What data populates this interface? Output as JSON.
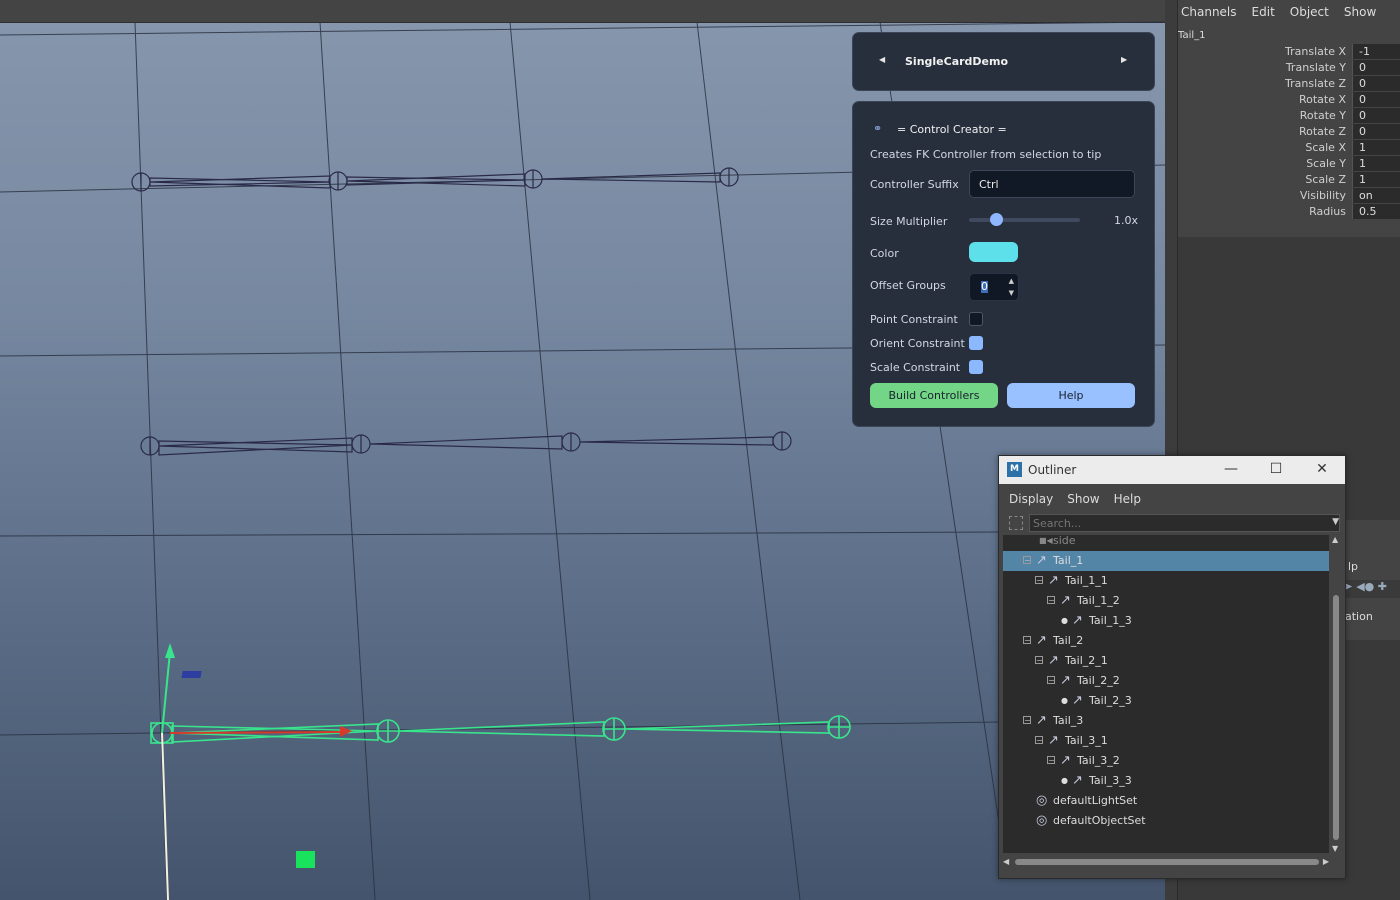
{
  "channel_box": {
    "menu": [
      "Channels",
      "Edit",
      "Object",
      "Show"
    ],
    "object_name": "Tail_1",
    "attributes": [
      {
        "label": "Translate X",
        "value": "-1"
      },
      {
        "label": "Translate Y",
        "value": "0"
      },
      {
        "label": "Translate Z",
        "value": "0"
      },
      {
        "label": "Rotate X",
        "value": "0"
      },
      {
        "label": "Rotate Y",
        "value": "0"
      },
      {
        "label": "Rotate Z",
        "value": "0"
      },
      {
        "label": "Scale X",
        "value": "1"
      },
      {
        "label": "Scale Y",
        "value": "1"
      },
      {
        "label": "Scale Z",
        "value": "1"
      },
      {
        "label": "Visibility",
        "value": "on"
      },
      {
        "label": "Radius",
        "value": "0.5"
      }
    ],
    "fragment_lp": "lp",
    "fragment_ation": "ation"
  },
  "card_nav": {
    "title": "SingleCardDemo",
    "prev_icon": "triangle-left",
    "next_icon": "triangle-right"
  },
  "control_creator": {
    "title": "= Control Creator =",
    "description": "Creates FK Controller from selection to tip",
    "suffix_label": "Controller Suffix",
    "suffix_value": "Ctrl",
    "size_label": "Size Multiplier",
    "size_value": "1.0x",
    "size_fraction": 0.24,
    "color_label": "Color",
    "color_value": "#5ee0ea",
    "offset_label": "Offset Groups",
    "offset_value": "0",
    "point_label": "Point Constraint",
    "point_checked": false,
    "orient_label": "Orient Constraint",
    "orient_checked": true,
    "scale_label": "Scale Constraint",
    "scale_checked": true,
    "build_label": "Build Controllers",
    "help_label": "Help"
  },
  "outliner": {
    "title": "Outliner",
    "menu": [
      "Display",
      "Show",
      "Help"
    ],
    "search_placeholder": "Search...",
    "items": [
      {
        "label": "side",
        "depth": 0,
        "type": "camera",
        "expander": "none",
        "dim": true
      },
      {
        "label": "Tail_1",
        "depth": 0,
        "type": "joint",
        "expander": "minus",
        "selected": true
      },
      {
        "label": "Tail_1_1",
        "depth": 1,
        "type": "joint",
        "expander": "minus"
      },
      {
        "label": "Tail_1_2",
        "depth": 2,
        "type": "joint",
        "expander": "minus"
      },
      {
        "label": "Tail_1_3",
        "depth": 3,
        "type": "joint",
        "expander": "dot"
      },
      {
        "label": "Tail_2",
        "depth": 0,
        "type": "joint",
        "expander": "minus"
      },
      {
        "label": "Tail_2_1",
        "depth": 1,
        "type": "joint",
        "expander": "minus"
      },
      {
        "label": "Tail_2_2",
        "depth": 2,
        "type": "joint",
        "expander": "minus"
      },
      {
        "label": "Tail_2_3",
        "depth": 3,
        "type": "joint",
        "expander": "dot"
      },
      {
        "label": "Tail_3",
        "depth": 0,
        "type": "joint",
        "expander": "minus"
      },
      {
        "label": "Tail_3_1",
        "depth": 1,
        "type": "joint",
        "expander": "minus"
      },
      {
        "label": "Tail_3_2",
        "depth": 2,
        "type": "joint",
        "expander": "minus"
      },
      {
        "label": "Tail_3_3",
        "depth": 3,
        "type": "joint",
        "expander": "dot"
      },
      {
        "label": "defaultLightSet",
        "depth": 0,
        "type": "set",
        "expander": "none"
      },
      {
        "label": "defaultObjectSet",
        "depth": 0,
        "type": "set",
        "expander": "none"
      }
    ]
  },
  "colors": {
    "accent_green": "#73d586",
    "accent_blue": "#99c0ff",
    "selected_row": "#5285a6",
    "selected_joint": "#39e58c"
  }
}
